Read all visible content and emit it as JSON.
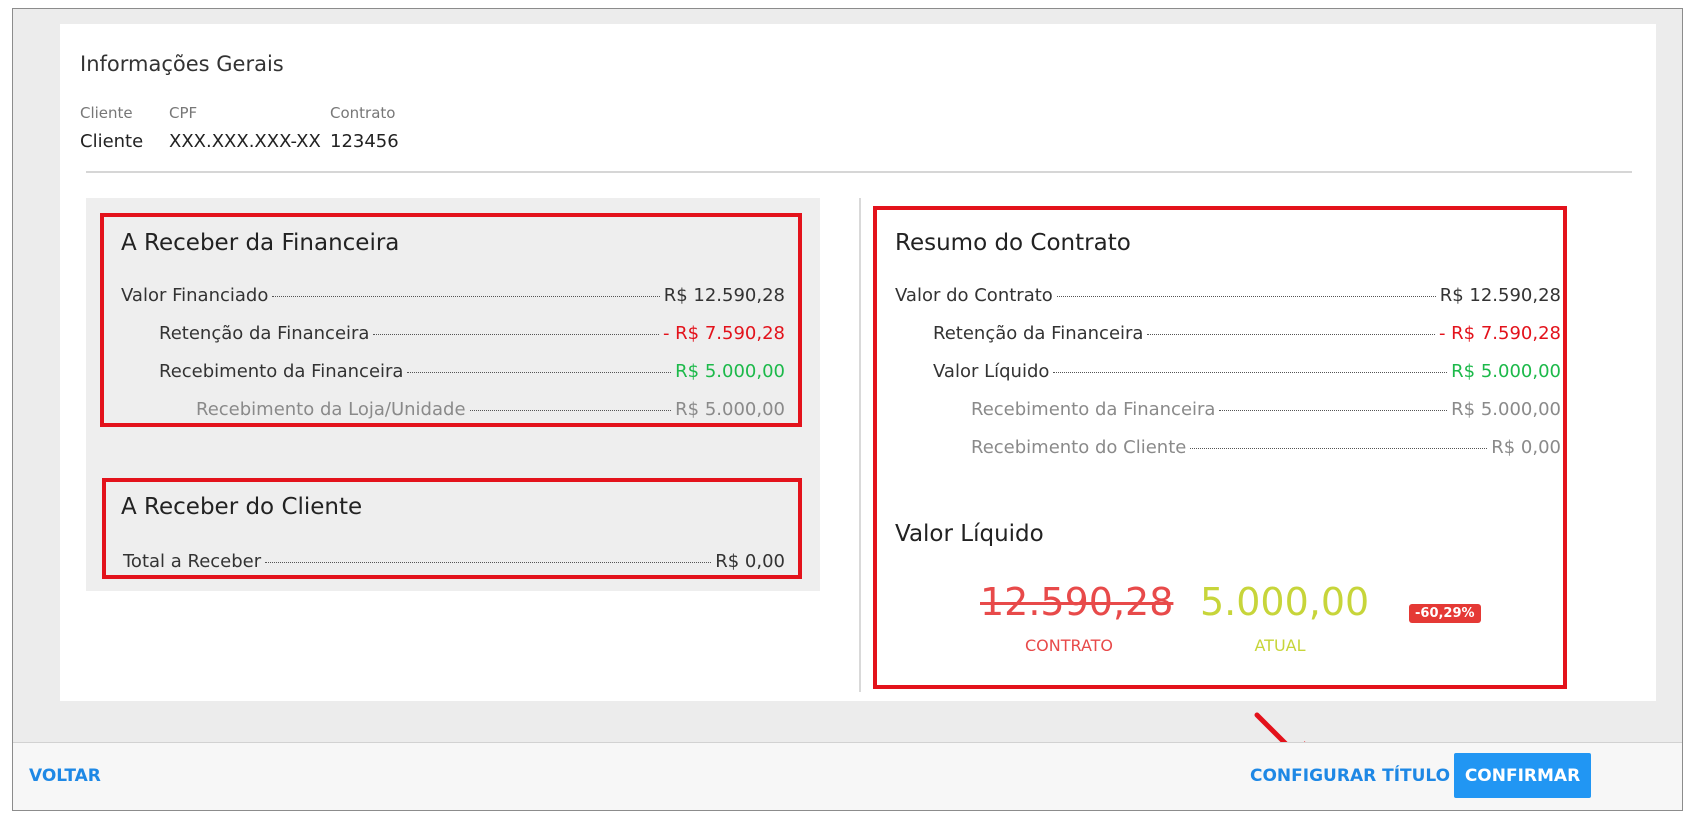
{
  "general_info": {
    "title": "Informações Gerais",
    "fields": [
      {
        "label": "Cliente",
        "value": "Cliente"
      },
      {
        "label": "CPF",
        "value": "XXX.XXX.XXX-XX"
      },
      {
        "label": "Contrato",
        "value": "123456"
      }
    ]
  },
  "financeira": {
    "title": "A Receber da Financeira",
    "rows": [
      {
        "label": "Valor Financiado",
        "value": "R$ 12.590,28"
      },
      {
        "label": "Retenção da Financeira",
        "value": "- R$ 7.590,28"
      },
      {
        "label": "Recebimento da Financeira",
        "value": "R$ 5.000,00"
      },
      {
        "label": "Recebimento da Loja/Unidade",
        "value": "R$ 5.000,00"
      }
    ]
  },
  "cliente": {
    "title": "A Receber do Cliente",
    "rows": [
      {
        "label": "Total a Receber",
        "value": "R$ 0,00"
      }
    ]
  },
  "resumo": {
    "title": "Resumo do Contrato",
    "rows": [
      {
        "label": "Valor do Contrato",
        "value": "R$ 12.590,28"
      },
      {
        "label": "Retenção da Financeira",
        "value": "- R$ 7.590,28"
      },
      {
        "label": "Valor Líquido",
        "value": "R$ 5.000,00"
      },
      {
        "label": "Recebimento da Financeira",
        "value": "R$ 5.000,00"
      },
      {
        "label": "Recebimento do Cliente",
        "value": "R$ 0,00"
      }
    ]
  },
  "valor_liquido": {
    "title": "Valor Líquido",
    "contract_value": "12.590,28",
    "contract_caption": "CONTRATO",
    "current_value": "5.000,00",
    "current_caption": "ATUAL",
    "percent_badge": "-60,29%"
  },
  "footer": {
    "back_label": "VOLTAR",
    "configure_label": "CONFIGURAR TÍTULO",
    "confirm_label": "CONFIRMAR"
  },
  "colors": {
    "highlight_border": "#e3121b",
    "negative": "#e3121b",
    "positive": "#1cb94a",
    "link": "#1e88e5",
    "primary_button": "#2196f3",
    "current_value": "#c7d53a"
  },
  "icons": {
    "annotation_arrow": "red-arrow-icon"
  }
}
